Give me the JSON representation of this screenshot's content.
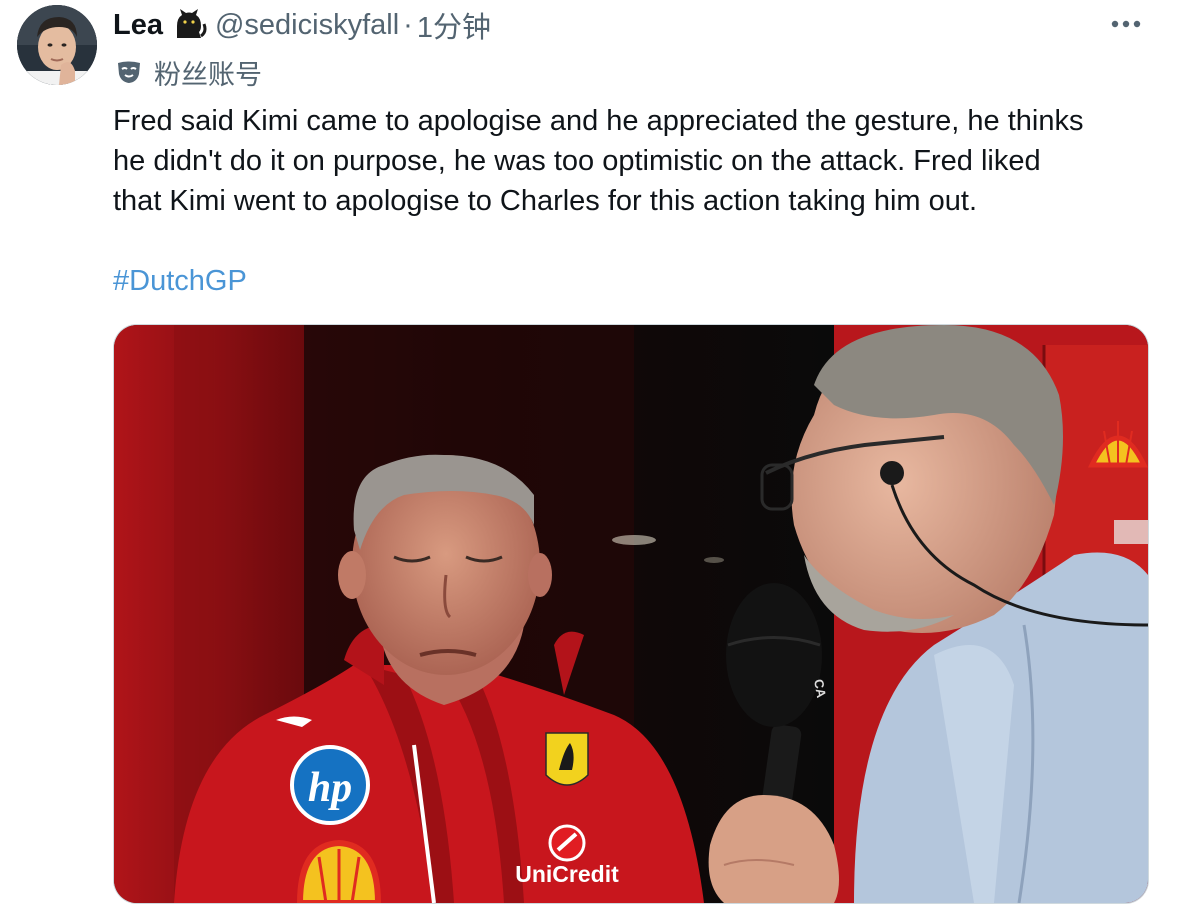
{
  "author": {
    "display_name": "Lea",
    "name_emoji_icon": "cat-icon",
    "handle": "@sediciskyfall",
    "separator": "·",
    "time": "1分钟",
    "avatar_icon": "avatar"
  },
  "badge": {
    "icon": "mask-icon",
    "label": "粉丝账号"
  },
  "more_icon": "more-icon",
  "tweet": {
    "text_lines": [
      "Fred said Kimi came to apologise and he appreciated the gesture, he thinks",
      "he didn't do it on purpose, he was too optimistic on the attack. Fred liked",
      "that Kimi went to apologise to Charles for this action taking him out."
    ],
    "hashtag": "#DutchGP"
  },
  "media": {
    "type": "video-still",
    "logo_hp": "hp",
    "logo_unicredit": "UniCredit",
    "mic_flag": "CA"
  },
  "colors": {
    "text": "#0f1419",
    "secondary": "#536471",
    "link": "#4a95d6",
    "border": "#cfd9de",
    "ferrari_red": "#c8161d"
  }
}
